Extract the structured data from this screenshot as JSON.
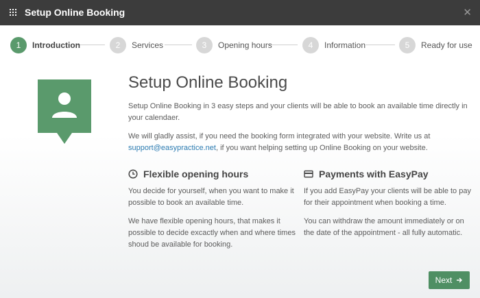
{
  "window": {
    "title": "Setup Online Booking",
    "close_glyph": "✕"
  },
  "steps": [
    {
      "number": "1",
      "label": "Introduction",
      "active": true
    },
    {
      "number": "2",
      "label": "Services",
      "active": false
    },
    {
      "number": "3",
      "label": "Opening hours",
      "active": false
    },
    {
      "number": "4",
      "label": "Information",
      "active": false
    },
    {
      "number": "5",
      "label": "Ready for use",
      "active": false
    }
  ],
  "intro": {
    "heading": "Setup Online Booking",
    "paragraph1": "Setup Online Booking in 3 easy steps and your clients will be able to book an available time directly in your calendaer.",
    "paragraph2_before": "We will gladly assist, if you need the booking form integrated with your website. Write us at",
    "email": "support@easypractice.net",
    "paragraph2_after": ", if you want helping setting up Online Booking on your website."
  },
  "features": [
    {
      "icon": "clock-icon",
      "title": "Flexible opening hours",
      "paragraphs": [
        "You decide for yourself, when you want to make it possible to book an available time.",
        "We have flexible opening hours, that makes it possible to decide excactly when and where times shoud be available for booking."
      ]
    },
    {
      "icon": "credit-card-icon",
      "title": "Payments with EasyPay",
      "paragraphs": [
        "If you add EasyPay your clients will be able to pay for their appointment when booking a time.",
        "You can withdraw the amount immediately or on the date of the appointment - all fully automatic."
      ]
    }
  ],
  "footer": {
    "next_label": "Next",
    "next_icon": "arrow-right-icon"
  },
  "colors": {
    "accent": "#5a9a6c",
    "button": "#4f8f63",
    "titlebar": "#3c3c3c",
    "link": "#2a7ab0"
  }
}
